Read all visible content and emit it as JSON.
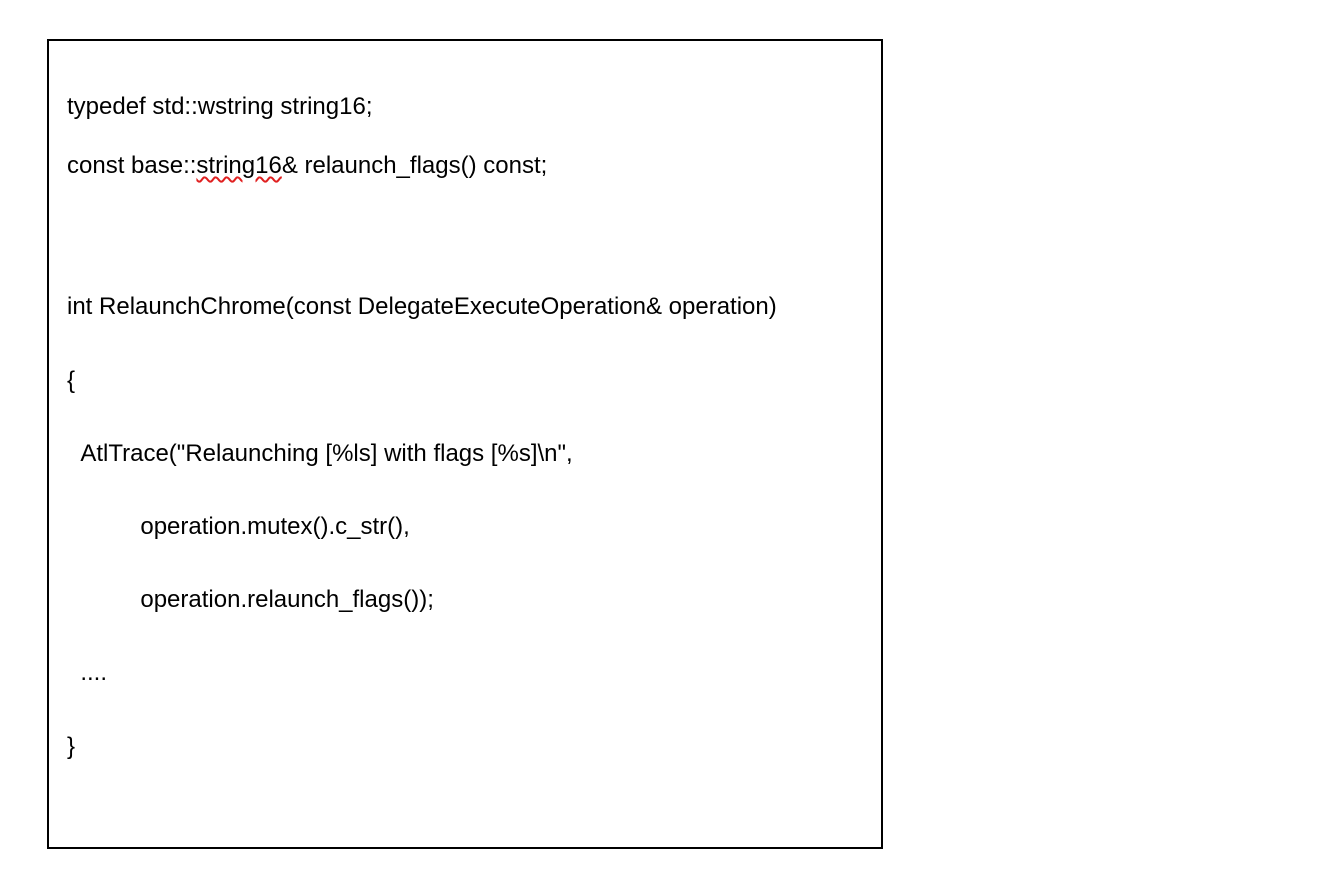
{
  "lines": {
    "l1_pre": "typedef std::wstring string16;",
    "l2_pre": "const base::",
    "l2_squiggle": "string16",
    "l2_post": "& relaunch_flags() const;",
    "l3": "int RelaunchChrome(const DelegateExecuteOperation& operation)",
    "l4": "{",
    "l5": "  AtlTrace(\"Relaunching [%ls] with flags [%s]\\n\",",
    "l6": "           operation.mutex().c_str(),",
    "l7": "           operation.relaunch_flags());",
    "l8": "  ....",
    "l9": "}"
  }
}
